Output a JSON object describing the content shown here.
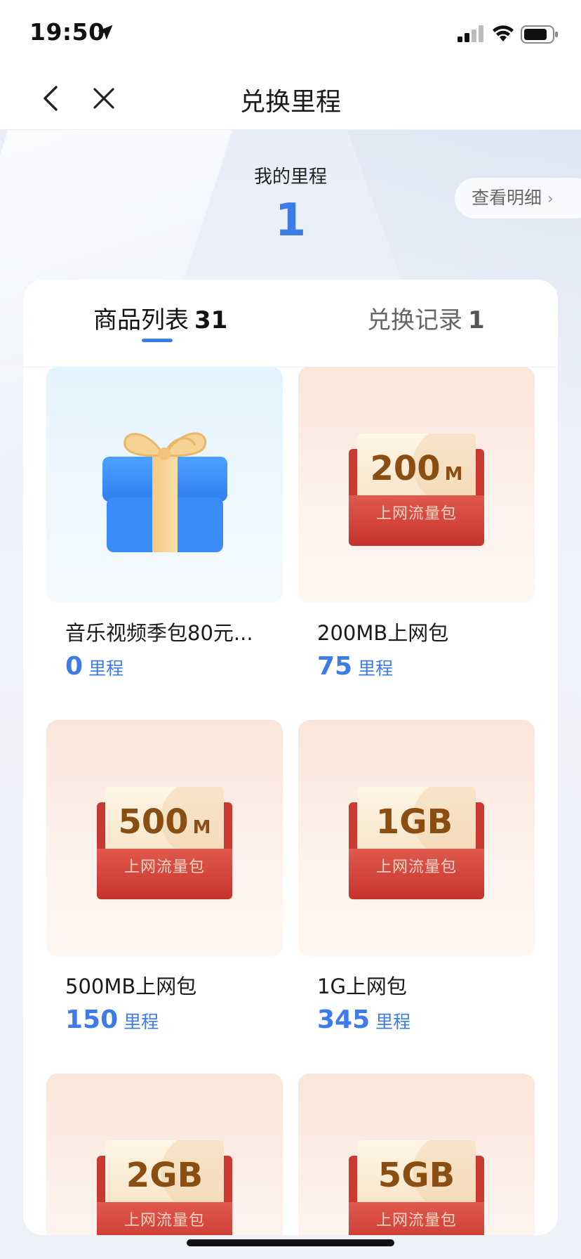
{
  "status_bar": {
    "time": "19:50"
  },
  "nav": {
    "title": "兑换里程"
  },
  "header": {
    "my_label": "我的里程",
    "my_value": "1",
    "detail_button": "查看明细"
  },
  "tabs": [
    {
      "label": "商品列表",
      "count": "31",
      "active": true
    },
    {
      "label": "兑换记录",
      "count": "1",
      "active": false
    }
  ],
  "items": [
    {
      "name": "音乐视频季包80元...",
      "price": "0",
      "unit": "里程",
      "image": "gift-box-icon"
    },
    {
      "name": "200MB上网包",
      "price": "75",
      "unit": "里程",
      "image": "data-envelope",
      "badge_size": "200",
      "badge_unit": "M",
      "badge_text": "上网流量包"
    },
    {
      "name": "500MB上网包",
      "price": "150",
      "unit": "里程",
      "image": "data-envelope",
      "badge_size": "500",
      "badge_unit": "M",
      "badge_text": "上网流量包"
    },
    {
      "name": "1G上网包",
      "price": "345",
      "unit": "里程",
      "image": "data-envelope",
      "badge_size": "1GB",
      "badge_unit": "",
      "badge_text": "上网流量包"
    },
    {
      "image": "data-envelope",
      "badge_size": "2GB",
      "badge_unit": "",
      "badge_text": "上网流量包"
    },
    {
      "image": "data-envelope",
      "badge_size": "5GB",
      "badge_unit": "",
      "badge_text": "上网流量包"
    }
  ],
  "colors": {
    "accent": "#3d7be8",
    "envelope_red": "#c93a32"
  }
}
